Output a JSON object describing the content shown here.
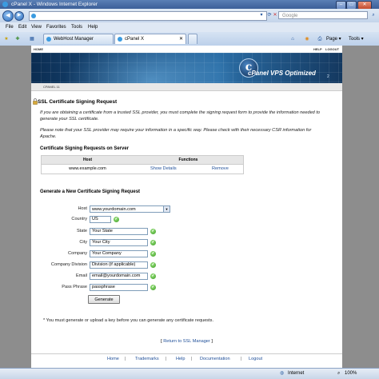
{
  "window": {
    "title": "cPanel X - Windows Internet Explorer"
  },
  "toolbar": {
    "address": "",
    "search_placeholder": "Google"
  },
  "menu": {
    "items": [
      "File",
      "Edit",
      "View",
      "Favorites",
      "Tools",
      "Help"
    ]
  },
  "tabs": [
    {
      "label": "WebHost Manager"
    },
    {
      "label": "cPanel X"
    }
  ],
  "tab_toolbar": {
    "page": "Page",
    "tools": "Tools"
  },
  "header": {
    "nav_home": "HOME",
    "nav_help": "HELP",
    "nav_logout": "LOGOUT",
    "brand": "cPanel VPS Optimized",
    "brand_num": "2",
    "breadcrumb": "CPANEL 11"
  },
  "main": {
    "title": "SSL Certificate Signing Request",
    "intro1": "If you are obtaining a certificate from a trusted SSL provider, you must complete the signing request form to provide the information needed to generate your SSL certificate.",
    "intro2": "Please note that your SSL provider may require your information in a specific way. Please check with their necessary CSR information for Apache.",
    "csr_heading": "Certificate Signing Requests on Server",
    "table": {
      "col_host": "Host",
      "col_functions": "Functions",
      "rows": [
        {
          "host": "www.example.com",
          "show": "Show Details",
          "remove": "Remove"
        }
      ]
    },
    "generate_heading": "Generate a New Certificate Signing Request",
    "form": {
      "host_label": "Host",
      "host_value": "www.yourdomain.com",
      "country_label": "Country",
      "country_value": "US",
      "state_label": "State",
      "state_value": "Your State",
      "city_label": "City",
      "city_value": "Your City",
      "company_label": "Company",
      "company_value": "Your Company",
      "division_label": "Company Division",
      "division_value": "Division (if applicable)",
      "email_label": "Email",
      "email_value": "email@yourdomain.com",
      "pass_label": "Pass Phrase",
      "pass_value": "passphrase",
      "generate_button": "Generate"
    },
    "note": "* You must generate or upload a key before you can generate any certificate requests.",
    "back_link": "Return to SSL Manager",
    "back_open": "[",
    "back_close": "]"
  },
  "footer": {
    "links": [
      "Home",
      "Trademarks",
      "Help",
      "Documentation",
      "Logout"
    ]
  },
  "status": {
    "zone": "Internet",
    "zoom": "100%"
  }
}
